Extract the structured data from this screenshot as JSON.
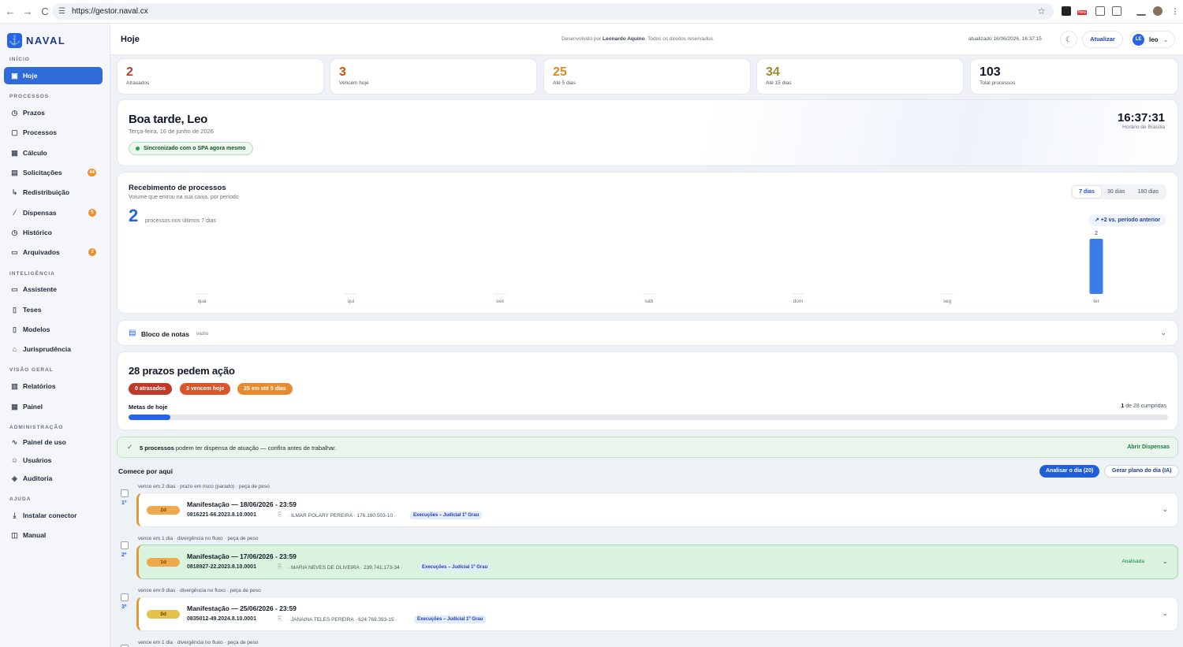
{
  "browser": {
    "url": "https://gestor.naval.cx",
    "nav_back_icon": "←",
    "nav_forward_icon": "→",
    "nav_reload_icon": "C",
    "tune_icon": "☰",
    "star_icon": "☆",
    "new_badge": "New"
  },
  "brand": {
    "name": "NAVAL",
    "logo_glyph": "⚓"
  },
  "sidebar": {
    "sections": [
      "INÍCIO",
      "PROCESSOS",
      "INTELIGÊNCIA",
      "VISÃO GERAL",
      "ADMINISTRAÇÃO",
      "AJUDA"
    ],
    "items": [
      {
        "label": "Hoje",
        "icon": "▣"
      },
      {
        "label": "Prazos",
        "icon": "◷"
      },
      {
        "label": "Processos",
        "icon": "▢"
      },
      {
        "label": "Cálculo",
        "icon": "▦"
      },
      {
        "label": "Solicitações",
        "icon": "▤",
        "badge": "44"
      },
      {
        "label": "Redistribuição",
        "icon": "↳"
      },
      {
        "label": "Dispensas",
        "icon": "⁄",
        "badge": "5"
      },
      {
        "label": "Histórico",
        "icon": "◷"
      },
      {
        "label": "Arquivados",
        "icon": "▭",
        "badge": "2"
      },
      {
        "label": "Assistente",
        "icon": "▭"
      },
      {
        "label": "Teses",
        "icon": "▯"
      },
      {
        "label": "Modelos",
        "icon": "▯"
      },
      {
        "label": "Jurisprudência",
        "icon": "⌂"
      },
      {
        "label": "Relatórios",
        "icon": "▥"
      },
      {
        "label": "Painel",
        "icon": "▦"
      },
      {
        "label": "Painel de uso",
        "icon": "∿"
      },
      {
        "label": "Usuários",
        "icon": "☺"
      },
      {
        "label": "Auditoria",
        "icon": "◈"
      },
      {
        "label": "Instalar conector",
        "icon": "⤓"
      },
      {
        "label": "Manual",
        "icon": "◫"
      }
    ]
  },
  "header": {
    "title": "Hoje",
    "credit_prefix": "Desenvolvido por",
    "credit_name": "Leonardo Aquino",
    "credit_suffix": ". Todos os direitos reservados.",
    "updated": "atualizado 16/06/2026, 16:37:15",
    "theme_icon": "☾",
    "refresh_label": "Atualizar",
    "user_initials": "LE",
    "user_name": "leo",
    "chevron": "⌄"
  },
  "stats": [
    {
      "value": "2",
      "label": "Atrasados",
      "color": "#c0392b"
    },
    {
      "value": "3",
      "label": "Vencem hoje",
      "color": "#d35400"
    },
    {
      "value": "25",
      "label": "Até 5 dias",
      "color": "#e08a1e"
    },
    {
      "value": "34",
      "label": "Até 15 dias",
      "color": "#a8872b"
    },
    {
      "value": "103",
      "label": "Total processos",
      "color": "#111827"
    }
  ],
  "greeting": {
    "title": "Boa tarde, Leo",
    "date": "Terça-feira, 16 de junho de 2026",
    "sync": "Sincronizado com o SPA agora mesmo",
    "clock": "16:37:31",
    "timezone": "Horário de Brasília"
  },
  "receipts": {
    "title": "Recebimento de processos",
    "subtitle": "Volume que entrou na sua caixa, por período",
    "total": "2",
    "total_caption": "processos nos últimos 7 dias",
    "periods": [
      "7 dias",
      "30 dias",
      "180 dias"
    ],
    "selected_period": "7 dias",
    "delta_icon": "↗",
    "delta": "+2 vs. período anterior"
  },
  "chart_data": {
    "type": "bar",
    "categories": [
      "qua",
      "qui",
      "sex",
      "sáb",
      "dom",
      "seg",
      "ter"
    ],
    "values": [
      0,
      0,
      0,
      0,
      0,
      0,
      2
    ],
    "data_labels": [
      "",
      "",
      "",
      "",
      "",
      "",
      "2"
    ],
    "ylim": [
      0,
      2
    ],
    "grid": false,
    "bar_color": "#3b7ce8"
  },
  "notes": {
    "icon": "▤",
    "title": "Bloco de notas",
    "status": "vazio",
    "chevron": "⌄"
  },
  "deadlines": {
    "title": "28 prazos pedem ação",
    "pills": [
      {
        "label": "0 atrasados",
        "color": "#c0392b"
      },
      {
        "label": "3 vencem hoje",
        "color": "#d9562b"
      },
      {
        "label": "25 em até 5 dias",
        "color": "#e8892c"
      }
    ],
    "goals_label": "Metas de hoje",
    "goals_done": "1",
    "goals_rest": "de 28 cumpridas",
    "goals_progress": 0.04
  },
  "dispensa_alert": {
    "icon": "✓",
    "count_text": "5 processos",
    "message": "podem ter dispensa de atuação — confira antes de trabalhar.",
    "link": "Abrir Dispensas"
  },
  "start": {
    "title": "Comece por aqui",
    "analyze_label": "Analisar o dia (20)",
    "plan_label": "Gerar plano do dia (IA)"
  },
  "tasks": [
    {
      "meta": "vence em 2 dias · prazo em risco (parado) · peça de peso",
      "rank": "1º",
      "days": "2d",
      "days_color": "#f0a94a",
      "title": "Manifestação — 18/06/2026 - 23:59",
      "process": "0816221-66.2023.8.10.0001",
      "copy_icon": "⎘",
      "party": "· ILMAR POLARY PEREIRA · 176.190.503-10 ·",
      "tag": "Execuções – Judicial 1º Grau",
      "status": "",
      "chevron": "⌄"
    },
    {
      "meta": "vence em 1 dia · divergência no fluxo · peça de peso",
      "rank": "2º",
      "days": "1d",
      "days_color": "#f0a94a",
      "title": "Manifestação — 17/06/2026 - 23:59",
      "process": "0818927-22.2023.8.10.0001",
      "copy_icon": "⎘",
      "party": "· MARIA NEVES DE OLIVEIRA · 239.741.173-34 ·",
      "tag": "Execuções – Judicial 1º Grau",
      "status": "Analisada",
      "chevron": "⌄"
    },
    {
      "meta": "vence em 9 dias · divergência no fluxo · peça de peso",
      "rank": "3º",
      "days": "9d",
      "days_color": "#e2c24a",
      "title": "Manifestação — 25/06/2026 - 23:59",
      "process": "0835012-49.2024.8.10.0001",
      "copy_icon": "⎘",
      "party": "· JANAINA TELES PEREIRA · 624.769.393-15 ·",
      "tag": "Execuções – Judicial 1º Grau",
      "status": "",
      "chevron": "⌄"
    },
    {
      "meta": "vence em 1 dia · divergência no fluxo · peça de peso"
    }
  ]
}
